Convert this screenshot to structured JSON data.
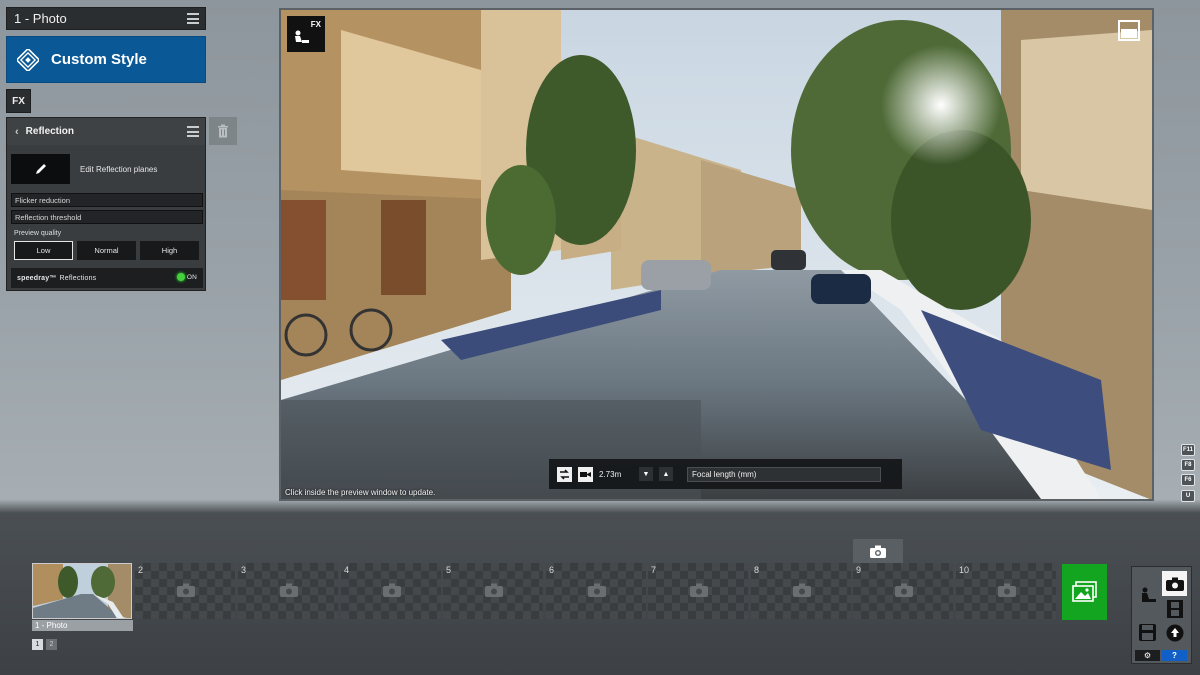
{
  "panel": {
    "photo_title": "1 - Photo",
    "style_title": "Custom Style",
    "fx_tab": "FX",
    "effect": {
      "title": "Reflection",
      "edit_label": "Edit Reflection planes",
      "flicker_label": "Flicker reduction",
      "threshold_label": "Reflection threshold",
      "preview_quality_label": "Preview quality",
      "quality_options": [
        "Low",
        "Normal",
        "High"
      ],
      "quality_selected": "Low",
      "speedray_brand": "speedray™",
      "speedray_label": "Reflections",
      "speedray_state": "ON"
    }
  },
  "preview": {
    "badge": "FX",
    "hint": "Click inside the preview window to update.",
    "camera_height": "2.73m",
    "focal_select": "Focal length (mm)"
  },
  "shortcuts": [
    "F11",
    "F8",
    "F6",
    "U"
  ],
  "filmstrip": {
    "slots": [
      "2",
      "3",
      "4",
      "5",
      "6",
      "7",
      "8",
      "9",
      "10"
    ],
    "first_label": "1 - Photo",
    "pages": [
      "1",
      "2"
    ]
  },
  "modes": {
    "help": "?"
  },
  "colors": {
    "accent_blue": "#0a5896",
    "gallery_green": "#13a51f",
    "toggle_on": "#44d13b"
  },
  "icons": {
    "style": "layers-icon",
    "edit": "pencil-icon",
    "trash": "trash-icon",
    "fx": "fx-worker-icon",
    "fullscreen": "fullscreen-icon",
    "camera": "camera-icon",
    "gallery": "gallery-icon",
    "photo_mode": "photo-mode-icon",
    "movie_mode": "film-icon",
    "save": "floppy-icon",
    "upload": "upload-icon",
    "settings": "gear-icon",
    "help": "help-icon"
  }
}
